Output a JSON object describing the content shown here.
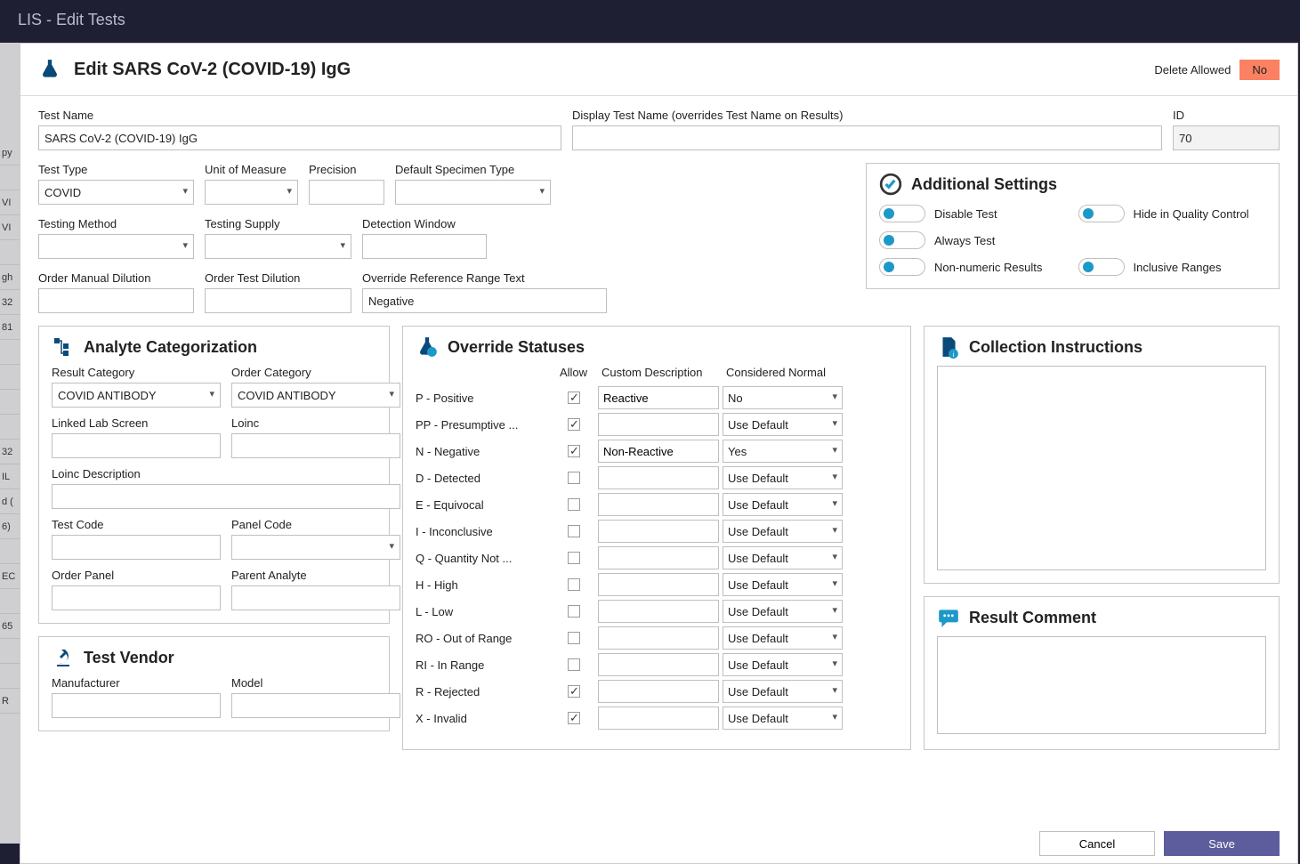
{
  "titlebar": "LIS - Edit Tests",
  "header": {
    "title": "Edit SARS CoV-2 (COVID-19) IgG",
    "delete_allowed_label": "Delete Allowed",
    "delete_allowed_value": "No"
  },
  "fields": {
    "test_name_label": "Test Name",
    "test_name_value": "SARS CoV-2 (COVID-19) IgG",
    "display_name_label": "Display Test Name (overrides Test Name on Results)",
    "display_name_value": "",
    "id_label": "ID",
    "id_value": "70",
    "test_type_label": "Test Type",
    "test_type_value": "COVID",
    "uom_label": "Unit of Measure",
    "uom_value": "",
    "precision_label": "Precision",
    "precision_value": "",
    "specimen_label": "Default Specimen Type",
    "specimen_value": "",
    "testing_method_label": "Testing Method",
    "testing_method_value": "",
    "testing_supply_label": "Testing Supply",
    "testing_supply_value": "",
    "detection_window_label": "Detection Window",
    "detection_window_value": "",
    "order_manual_dilution_label": "Order Manual Dilution",
    "order_manual_dilution_value": "",
    "order_test_dilution_label": "Order Test Dilution",
    "order_test_dilution_value": "",
    "override_ref_label": "Override Reference Range Text",
    "override_ref_value": "Negative"
  },
  "settings": {
    "title": "Additional Settings",
    "toggles": {
      "disable_test": "Disable Test",
      "hide_qc": "Hide in Quality Control",
      "always_test": "Always Test",
      "non_numeric": "Non-numeric Results",
      "inclusive_ranges": "Inclusive Ranges"
    }
  },
  "analyte": {
    "title": "Analyte Categorization",
    "result_category_label": "Result Category",
    "result_category_value": "COVID ANTIBODY",
    "order_category_label": "Order Category",
    "order_category_value": "COVID ANTIBODY",
    "linked_lab_label": "Linked Lab Screen",
    "loinc_label": "Loinc",
    "loinc_desc_label": "Loinc Description",
    "test_code_label": "Test Code",
    "panel_code_label": "Panel Code",
    "order_panel_label": "Order Panel",
    "parent_analyte_label": "Parent Analyte"
  },
  "vendor": {
    "title": "Test Vendor",
    "manufacturer_label": "Manufacturer",
    "model_label": "Model"
  },
  "override": {
    "title": "Override Statuses",
    "head_allow": "Allow",
    "head_desc": "Custom Description",
    "head_normal": "Considered Normal",
    "rows": [
      {
        "label": "P - Positive",
        "allow": true,
        "desc": "Reactive",
        "normal": "No"
      },
      {
        "label": "PP - Presumptive ...",
        "allow": true,
        "desc": "",
        "normal": "Use Default"
      },
      {
        "label": "N - Negative",
        "allow": true,
        "desc": "Non-Reactive",
        "normal": "Yes"
      },
      {
        "label": "D - Detected",
        "allow": false,
        "desc": "",
        "normal": "Use Default"
      },
      {
        "label": "E - Equivocal",
        "allow": false,
        "desc": "",
        "normal": "Use Default"
      },
      {
        "label": "I - Inconclusive",
        "allow": false,
        "desc": "",
        "normal": "Use Default"
      },
      {
        "label": "Q - Quantity Not ...",
        "allow": false,
        "desc": "",
        "normal": "Use Default"
      },
      {
        "label": "H - High",
        "allow": false,
        "desc": "",
        "normal": "Use Default"
      },
      {
        "label": "L - Low",
        "allow": false,
        "desc": "",
        "normal": "Use Default"
      },
      {
        "label": "RO - Out of Range",
        "allow": false,
        "desc": "",
        "normal": "Use Default"
      },
      {
        "label": "RI - In Range",
        "allow": false,
        "desc": "",
        "normal": "Use Default"
      },
      {
        "label": "R - Rejected",
        "allow": true,
        "desc": "",
        "normal": "Use Default"
      },
      {
        "label": "X - Invalid",
        "allow": true,
        "desc": "",
        "normal": "Use Default"
      }
    ]
  },
  "collection": {
    "title": "Collection Instructions"
  },
  "result_comment": {
    "title": "Result Comment"
  },
  "footer": {
    "cancel": "Cancel",
    "save": "Save"
  },
  "bg_rows": [
    "py",
    "",
    "VI",
    "VI",
    "",
    "gh",
    "32",
    "81",
    "",
    "",
    "",
    "",
    "32",
    "IL",
    "d (",
    "6)",
    "",
    "EC",
    "",
    "65",
    "",
    "",
    "R"
  ]
}
